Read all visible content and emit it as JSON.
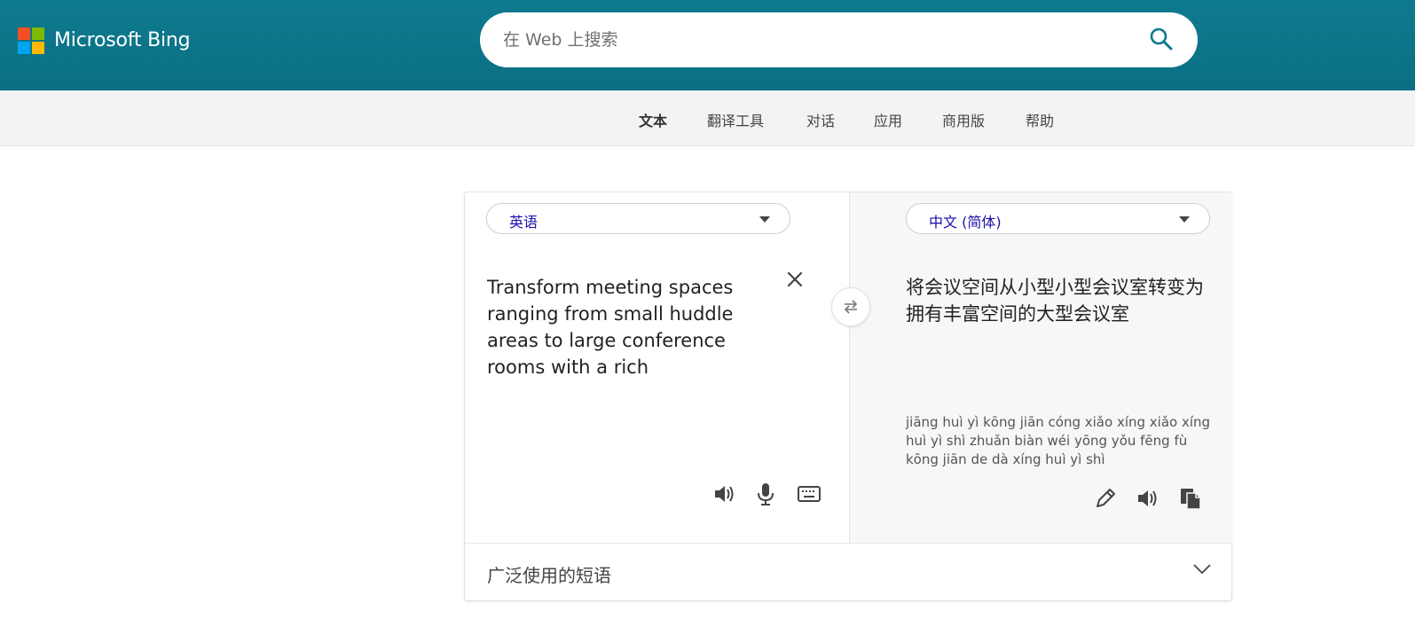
{
  "header": {
    "brand": "Microsoft Bing",
    "search_placeholder": "在 Web 上搜索"
  },
  "nav": {
    "items": [
      {
        "label": "文本",
        "active": true
      },
      {
        "label": "翻译工具",
        "active": false
      },
      {
        "label": "对话",
        "active": false
      },
      {
        "label": "应用",
        "active": false
      },
      {
        "label": "商用版",
        "active": false
      },
      {
        "label": "帮助",
        "active": false
      }
    ]
  },
  "translator": {
    "source_lang": "英语",
    "target_lang": "中文 (简体)",
    "source_text": "Transform meeting spaces ranging from small huddle areas to large conference rooms with a rich",
    "target_text": "将会议空间从小型小型会议室转变为拥有丰富空间的大型会议室",
    "pinyin": "jiāng huì yì kōng jiān cóng xiǎo xíng xiǎo xíng huì yì shì zhuǎn biàn wéi yōng yǒu fēng fù kōng jiān de dà xíng huì yì shì",
    "phrases_label": "广泛使用的短语"
  },
  "icons": {
    "search": "search-icon",
    "clear": "close-icon",
    "swap": "swap-icon",
    "speaker": "speaker-icon",
    "mic": "microphone-icon",
    "keyboard": "keyboard-icon",
    "edit": "pencil-icon",
    "copy": "copy-icon",
    "expand": "chevron-down-icon"
  },
  "colors": {
    "header_bg": "#0e7a8f",
    "accent": "#1a0dab"
  }
}
